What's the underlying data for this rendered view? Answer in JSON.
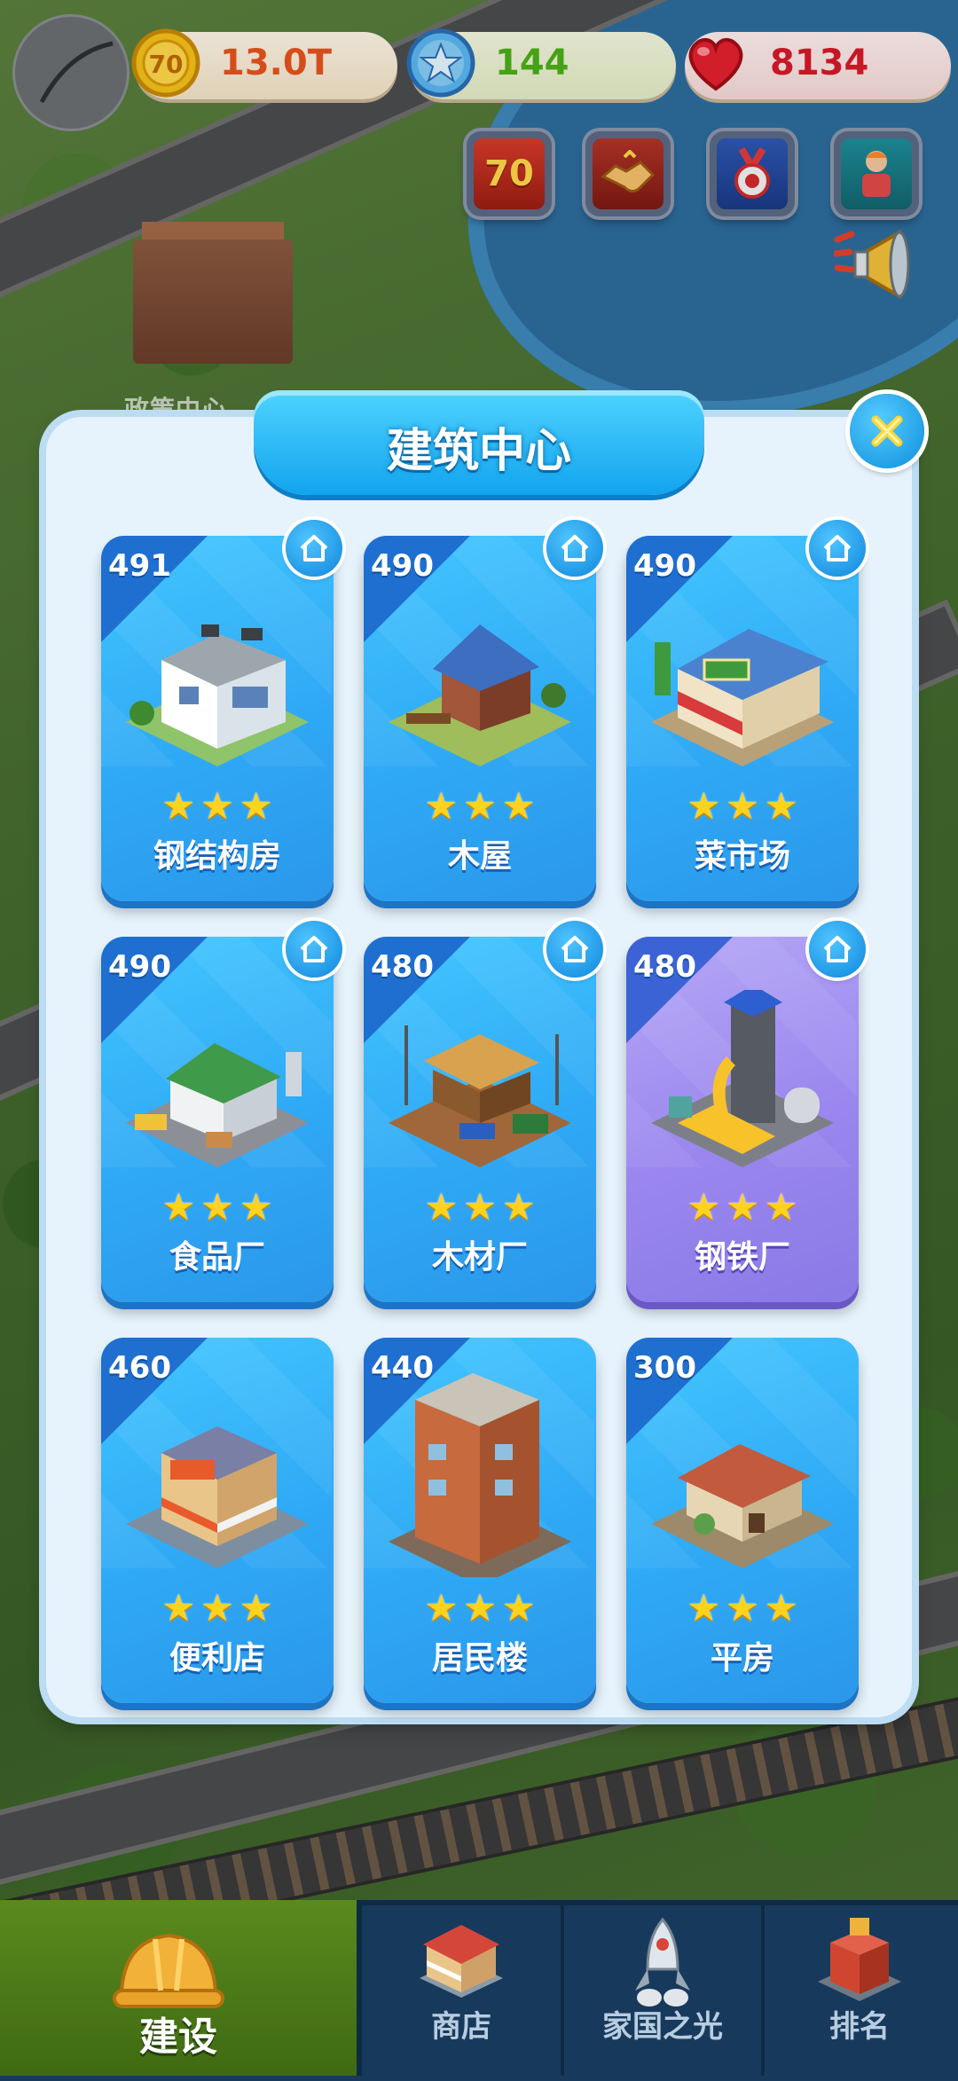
{
  "top_bar": {
    "coins": "13.0T",
    "coin_badge": "70",
    "stars": "144",
    "hearts": "8134"
  },
  "background": {
    "policy_center_label": "政策中心"
  },
  "event_icons": [
    {
      "name": "70",
      "icon": "seventy-anniversary-icon"
    },
    {
      "name": "",
      "icon": "handshake-icon"
    },
    {
      "name": "",
      "icon": "medal-icon"
    },
    {
      "name": "",
      "icon": "worker-icon"
    }
  ],
  "dialog": {
    "title": "建筑中心",
    "buildings": [
      {
        "level": "491",
        "name": "钢结构房",
        "stars": 3,
        "style": "blue"
      },
      {
        "level": "490",
        "name": "木屋",
        "stars": 3,
        "style": "blue"
      },
      {
        "level": "490",
        "name": "菜市场",
        "stars": 3,
        "style": "blue"
      },
      {
        "level": "490",
        "name": "食品厂",
        "stars": 3,
        "style": "blue"
      },
      {
        "level": "480",
        "name": "木材厂",
        "stars": 3,
        "style": "blue"
      },
      {
        "level": "480",
        "name": "钢铁厂",
        "stars": 3,
        "style": "purple"
      },
      {
        "level": "460",
        "name": "便利店",
        "stars": 3,
        "style": "blue"
      },
      {
        "level": "440",
        "name": "居民楼",
        "stars": 3,
        "style": "blue"
      },
      {
        "level": "300",
        "name": "平房",
        "stars": 3,
        "style": "blue"
      }
    ]
  },
  "bottom_nav": {
    "build": "建设",
    "shop": "商店",
    "glory": "家国之光",
    "rank": "排名"
  },
  "colors": {
    "card_blue": "#2fa9f5",
    "card_purple": "#9a86ee",
    "star": "#ffd21f",
    "coin_text": "#e8541d",
    "star_text": "#4caf16",
    "heart_text": "#d8192a"
  }
}
